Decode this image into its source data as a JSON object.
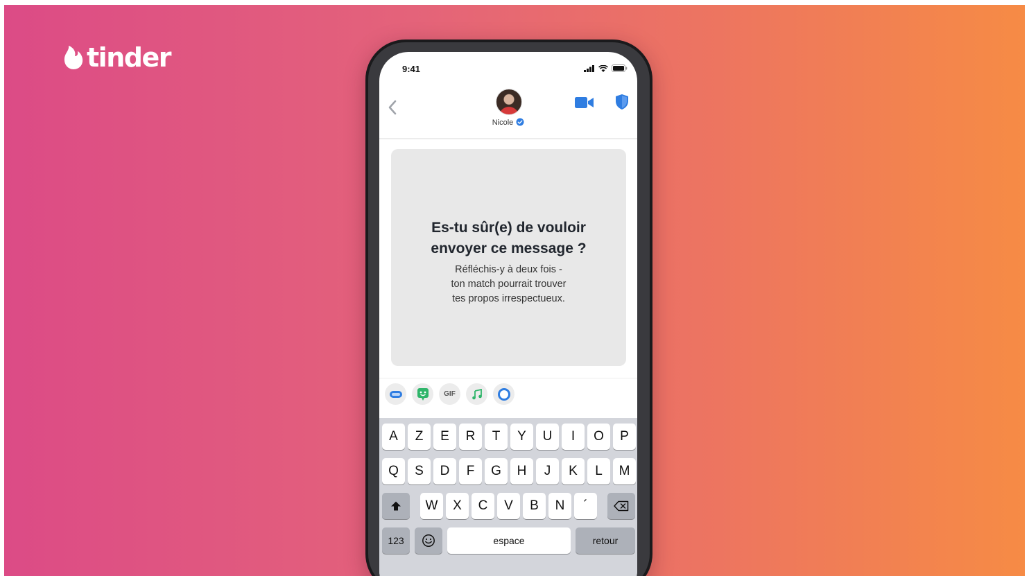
{
  "brand": {
    "logo_text": "tinder",
    "flame_icon": "flame-icon",
    "background_gradient": [
      "#dc4b86",
      "#f68b45"
    ]
  },
  "status_bar": {
    "time": "9:41",
    "icons": [
      "cellular-signal-icon",
      "wifi-icon",
      "battery-icon"
    ]
  },
  "chat_header": {
    "back_icon": "chevron-left-icon",
    "match_name": "Nicole",
    "verified_icon": "verified-badge-icon",
    "video_call_icon": "video-camera-icon",
    "safety_icon": "shield-icon",
    "accent_color": "#2f7de1"
  },
  "warning": {
    "title_line1": "Es-tu sûr(e) de vouloir",
    "title_line2": "envoyer ce message ?",
    "body_line1": "Réfléchis-y à deux fois -",
    "body_line2": "ton match pourrait trouver",
    "body_line3": "tes propos irrespectueux."
  },
  "toolbar": {
    "items": [
      {
        "name": "sticker-icon"
      },
      {
        "name": "bitmoji-icon"
      },
      {
        "name": "gif-icon",
        "label": "GIF"
      },
      {
        "name": "music-icon"
      },
      {
        "name": "circle-icon"
      }
    ]
  },
  "keyboard": {
    "row1": [
      "A",
      "Z",
      "E",
      "R",
      "T",
      "Y",
      "U",
      "I",
      "O",
      "P"
    ],
    "row2": [
      "Q",
      "S",
      "D",
      "F",
      "G",
      "H",
      "J",
      "K",
      "L",
      "M"
    ],
    "row3": [
      "W",
      "X",
      "C",
      "V",
      "B",
      "N",
      "´"
    ],
    "numbers_key": "123",
    "emoji_key": "emoji-icon",
    "space_key": "espace",
    "return_key": "retour",
    "shift_key": "shift-icon",
    "delete_key": "delete-icon"
  }
}
